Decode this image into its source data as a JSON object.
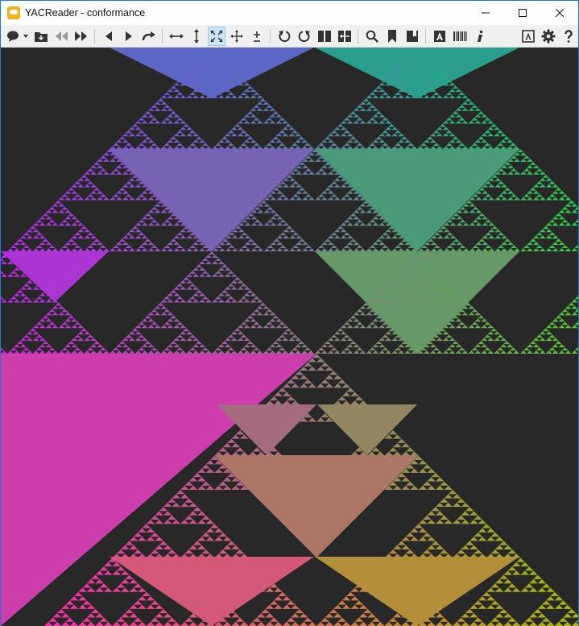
{
  "window": {
    "title": "YACReader - conformance",
    "controls": [
      "minimize",
      "maximize",
      "close"
    ]
  },
  "toolbar": {
    "left_icons": [
      "speech-bubble-icon",
      "open-folder-icon",
      "previous-comic-icon",
      "next-comic-icon",
      "previous-page-icon",
      "next-page-icon",
      "go-to-page-icon",
      "fit-width-icon",
      "fit-height-icon",
      "fit-page-icon",
      "original-size-icon",
      "zoom-slider-icon",
      "rotate-left-icon",
      "rotate-right-icon",
      "double-page-icon",
      "manga-mode-icon",
      "magnifier-icon",
      "bookmark-icon",
      "show-bookmarks-icon",
      "translator-icon",
      "show-dictionary-icon",
      "comic-info-icon"
    ],
    "right_icons": [
      "show-shortcuts-icon",
      "settings-icon",
      "help-icon"
    ],
    "active": "fit-page-icon"
  },
  "viewer": {
    "content": "sierpinski-gradient-page",
    "colors": {
      "background": "#282828",
      "top_left": "#8a2cff",
      "top_right": "#00cc66",
      "bottom_left": "#ff20b4",
      "bottom_right": "#a8b800",
      "accent_pink": "#ff2aa0",
      "accent_green": "#22cc33"
    }
  }
}
